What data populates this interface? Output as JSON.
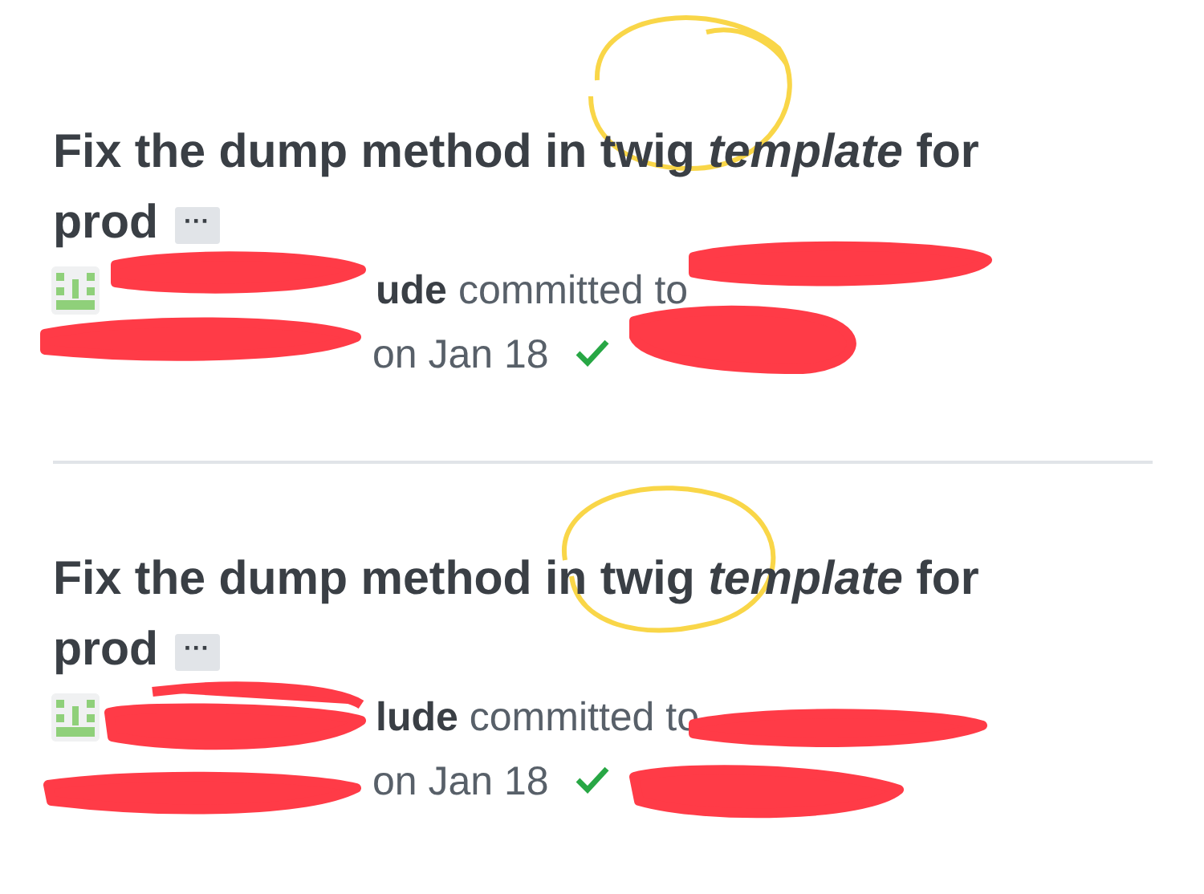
{
  "commits": [
    {
      "title": "Fix the dump method in twig *template* for prod",
      "more": "···",
      "author": "ude",
      "action": "committed to",
      "date": "on Jan 18",
      "checks_passed": true
    },
    {
      "title": "Fix the dump method in twig *template* for prod",
      "more": "···",
      "author": "lude",
      "action": "committed to",
      "date": "on Jan 18",
      "checks_passed": true
    }
  ]
}
